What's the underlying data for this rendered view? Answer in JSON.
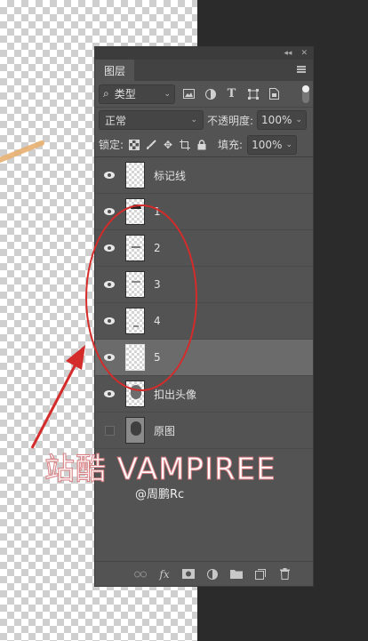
{
  "panel": {
    "title": "图层",
    "filter": {
      "value": "类型",
      "search_glyph": "⌕"
    },
    "blend_mode": "正常",
    "opacity_label": "不透明度:",
    "opacity_value": "100%",
    "lock_label": "锁定:",
    "fill_label": "填充:",
    "fill_value": "100%"
  },
  "layers": [
    {
      "name": "标记线",
      "visible": true,
      "thumb": "blank"
    },
    {
      "name": "1",
      "visible": true,
      "thumb": "mark"
    },
    {
      "name": "2",
      "visible": true,
      "thumb": "mark2"
    },
    {
      "name": "3",
      "visible": true,
      "thumb": "mark3"
    },
    {
      "name": "4",
      "visible": true,
      "thumb": "mark4"
    },
    {
      "name": "5",
      "visible": true,
      "thumb": "blank",
      "selected": true
    },
    {
      "name": "扣出头像",
      "visible": true,
      "thumb": "face"
    },
    {
      "name": "原图",
      "visible": false,
      "thumb": "photo"
    }
  ],
  "watermark": {
    "text": "站酷 VAMPIREE",
    "author": "@周鹏Rc"
  },
  "colors": {
    "annotation": "#d42b2b",
    "panel": "#535353",
    "selected_row": "#6b6b6b"
  }
}
